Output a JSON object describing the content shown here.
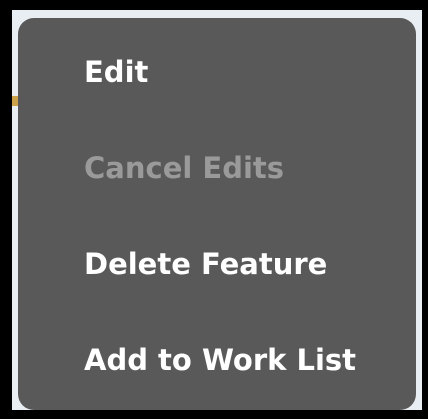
{
  "colors": {
    "menu_background": "#595959",
    "text_enabled": "#ffffff",
    "text_disabled": "#9a9a9a",
    "outer_frame": "#000000",
    "backdrop": "#e9eef2"
  },
  "context_menu": {
    "items": [
      {
        "label": "Edit",
        "enabled": true
      },
      {
        "label": "Cancel Edits",
        "enabled": false
      },
      {
        "label": "Delete Feature",
        "enabled": true
      },
      {
        "label": "Add to Work List",
        "enabled": true
      }
    ]
  }
}
